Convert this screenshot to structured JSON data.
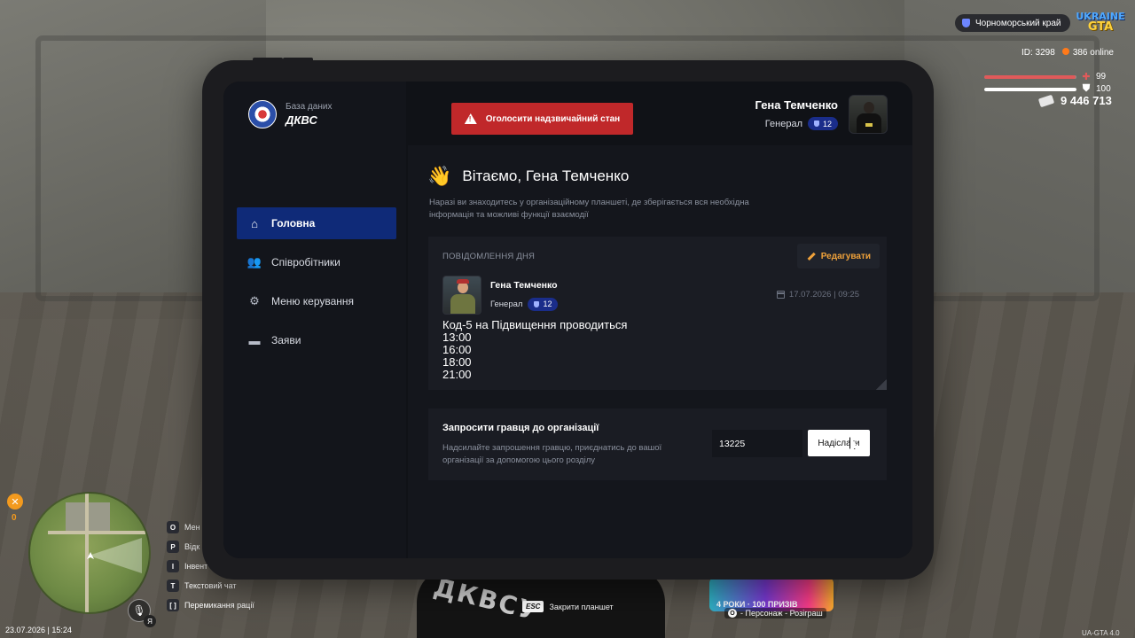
{
  "hud": {
    "region": "Чорноморський край",
    "logo_line1": "UKRAINE",
    "logo_line2": "GTA",
    "id_text": "ID: 3298",
    "online_text": "386 online",
    "health": 99,
    "armor": 100,
    "health_color": "#e05a5a",
    "armor_color": "#ffffff",
    "money": "9 446 713",
    "hunger_value": "0",
    "mic_badge": "Я",
    "datetime": "23.07.2026 | 15:24",
    "version": "UA-GTA 4.0",
    "keybinds": [
      {
        "key": "O",
        "label": "Мен"
      },
      {
        "key": "P",
        "label": "Відк"
      },
      {
        "key": "I",
        "label": "Інвент"
      },
      {
        "key": "T",
        "label": "Текстовий чат"
      },
      {
        "key": "[ ]",
        "label": "Перемикання рації"
      }
    ],
    "esc_key": "ESC",
    "esc_label": "Закрити планшет",
    "promo_text": "4 РОКИ · 100 ПРИЗІВ",
    "promo_key": "O",
    "promo_label": "- Персонаж - Розіграш"
  },
  "tablet": {
    "brand_sub": "База даних",
    "brand_name": "ДКВС",
    "alert_button": "Оголосити надзвичайний стан",
    "user": {
      "name": "Гена Темченко",
      "rank": "Генерал",
      "rank_level": "12"
    },
    "nav": [
      {
        "label": "Головна",
        "icon": "home-icon",
        "active": true
      },
      {
        "label": "Співробітники",
        "icon": "users-icon",
        "active": false
      },
      {
        "label": "Меню керування",
        "icon": "gear-icon",
        "active": false
      },
      {
        "label": "Заяви",
        "icon": "folder-icon",
        "active": false
      }
    ],
    "welcome_title": "Вітаємо, Гена Темченко",
    "welcome_desc": "Наразі ви знаходитесь у організаційному планшеті, де зберігається вся необхідна інформація та можливі функції взаємодії",
    "motd": {
      "label": "ПОВІДОМЛЕННЯ ДНЯ",
      "edit_button": "Редагувати",
      "author_name": "Гена Темченко",
      "author_rank": "Генерал",
      "author_level": "12",
      "date": "17.07.2026 | 09:25",
      "lines": [
        "Код-5 на Підвищення проводиться",
        "13:00",
        "16:00",
        "18:00",
        "21:00"
      ]
    },
    "invite": {
      "title": "Запросити гравця до організації",
      "desc": "Надсилайте запрошення гравцю, приєднатись до вашої організації за допомогою цього розділу",
      "input_value": "13225",
      "send_button": "Надіслати"
    }
  },
  "colors": {
    "accent_nav": "#0f2a78",
    "alert": "#c0282a",
    "edit": "#f0a23a"
  }
}
